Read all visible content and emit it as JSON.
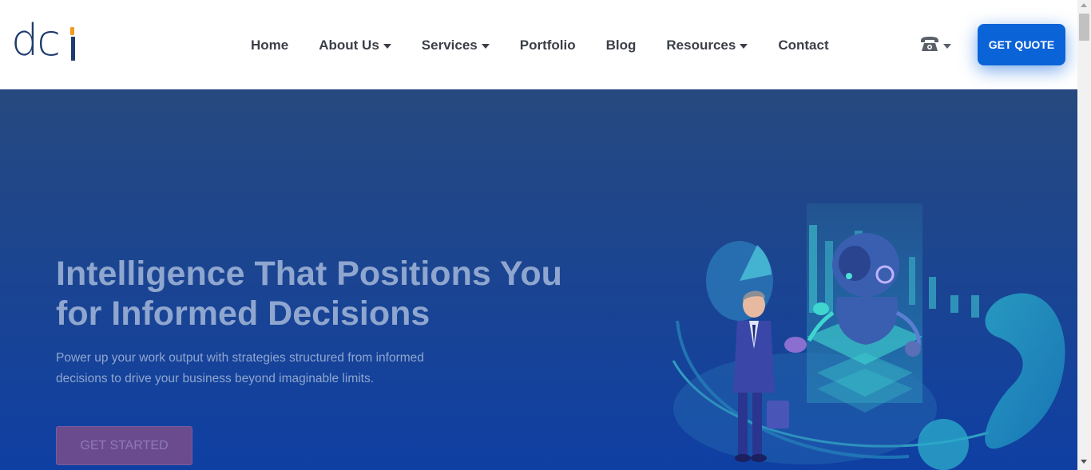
{
  "logo": {
    "text": "dc",
    "accent_color": "#f39a1e",
    "brand_color": "#1f3c6e"
  },
  "nav": {
    "items": [
      {
        "label": "Home",
        "has_dropdown": false
      },
      {
        "label": "About Us",
        "has_dropdown": true
      },
      {
        "label": "Services",
        "has_dropdown": true
      },
      {
        "label": "Portfolio",
        "has_dropdown": false
      },
      {
        "label": "Blog",
        "has_dropdown": false
      },
      {
        "label": "Resources",
        "has_dropdown": true
      },
      {
        "label": "Contact",
        "has_dropdown": false
      }
    ],
    "phone_icon": "telephone-icon",
    "quote_label": "GET QUOTE",
    "quote_color": "#0b63d8"
  },
  "hero": {
    "title_line1": "Intelligence That Positions You",
    "title_line2": "for Informed Decisions",
    "subtitle_line1": "Power up your work output with strategies structured from informed",
    "subtitle_line2": "decisions to drive your business beyond imaginable limits.",
    "cta_label": "GET STARTED",
    "illustration": "businessman-and-robot-illustration"
  },
  "colors": {
    "hero_top": "#26497f",
    "hero_bottom": "#0f3fa3",
    "text_muted": "#8fa6cf"
  }
}
